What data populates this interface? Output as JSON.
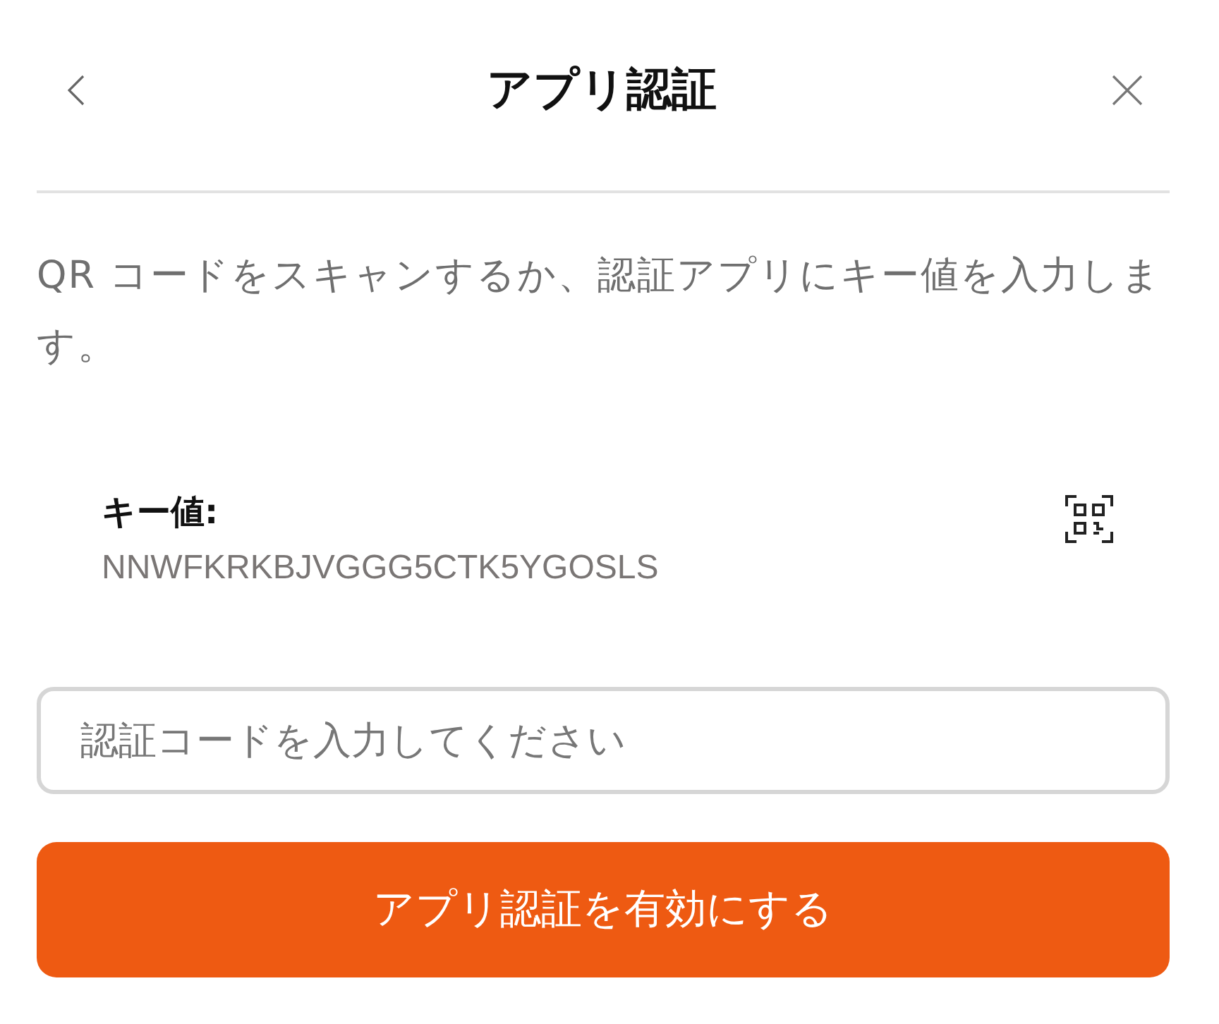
{
  "header": {
    "title": "アプリ認証"
  },
  "description": "QR コードをスキャンするか、認証アプリにキー値を入力します。",
  "key": {
    "label": "キー値:",
    "value": "NNWFKRKBJVGGG5CTK5YGOSLS"
  },
  "code_field": {
    "placeholder": "認証コードを入力してください"
  },
  "submit_button": {
    "label": "アプリ認証を有効にする"
  }
}
